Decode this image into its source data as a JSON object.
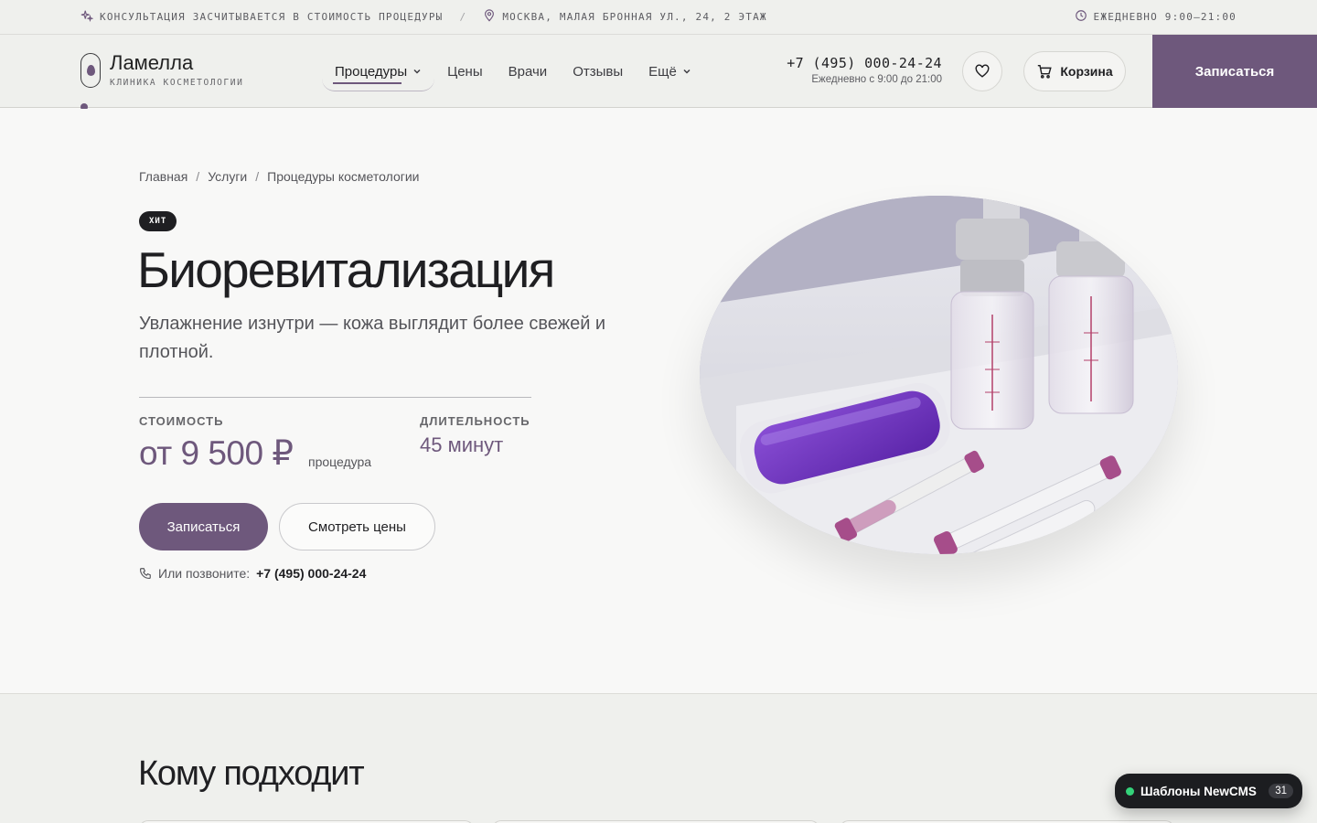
{
  "topbar": {
    "consultation": "КОНСУЛЬТАЦИЯ ЗАСЧИТЫВАЕТСЯ В СТОИМОСТЬ ПРОЦЕДУРЫ",
    "separator": "/",
    "address": "МОСКВА, МАЛАЯ БРОННАЯ УЛ., 24, 2 ЭТАЖ",
    "hours": "ЕЖЕДНЕВНО 9:00–21:00"
  },
  "header": {
    "brand_name": "Ламелла",
    "brand_sub": "клиника косметологии",
    "nav": [
      {
        "label": "Процедуры",
        "dropdown": true,
        "active": true
      },
      {
        "label": "Цены"
      },
      {
        "label": "Врачи"
      },
      {
        "label": "Отзывы"
      },
      {
        "label": "Ещё",
        "dropdown": true
      }
    ],
    "phone": "+7 (495) 000-24-24",
    "phone_hours": "Ежедневно с 9:00 до 21:00",
    "cart_label": "Корзина",
    "book_label": "Записаться"
  },
  "hero": {
    "breadcrumb": [
      "Главная",
      "Услуги",
      "Процедуры косметологии"
    ],
    "breadcrumb_sep": "/",
    "badge": "ХИТ",
    "title": "Биоревитализация",
    "subtitle": "Увлажнение изнутри — кожа выглядит более свежей и плотной.",
    "price_label": "СТОИМОСТЬ",
    "price": "от 9 500 ₽",
    "price_unit": "процедура",
    "duration_label": "ДЛИТЕЛЬНОСТЬ",
    "duration": "45 минут",
    "primary_button": "Записаться",
    "secondary_button": "Смотреть цены",
    "call_prefix": "Или позвоните:",
    "call_number": "+7 (495) 000-24-24"
  },
  "section2": {
    "title": "Кому подходит"
  },
  "widget": {
    "label": "Шаблоны NewCMS",
    "count": "31"
  },
  "colors": {
    "accent": "#6e587c",
    "dark": "#1f1f22",
    "bar_bg": "#eff0ed",
    "page_bg": "#f8f8f7",
    "online": "#34d27a"
  },
  "icons": {
    "consultation": "sparkles-icon",
    "address": "map-pin-icon",
    "hours": "clock-icon",
    "favorite": "heart-icon",
    "cart": "cart-icon",
    "call": "phone-icon",
    "dropdown": "chevron-down-icon"
  }
}
